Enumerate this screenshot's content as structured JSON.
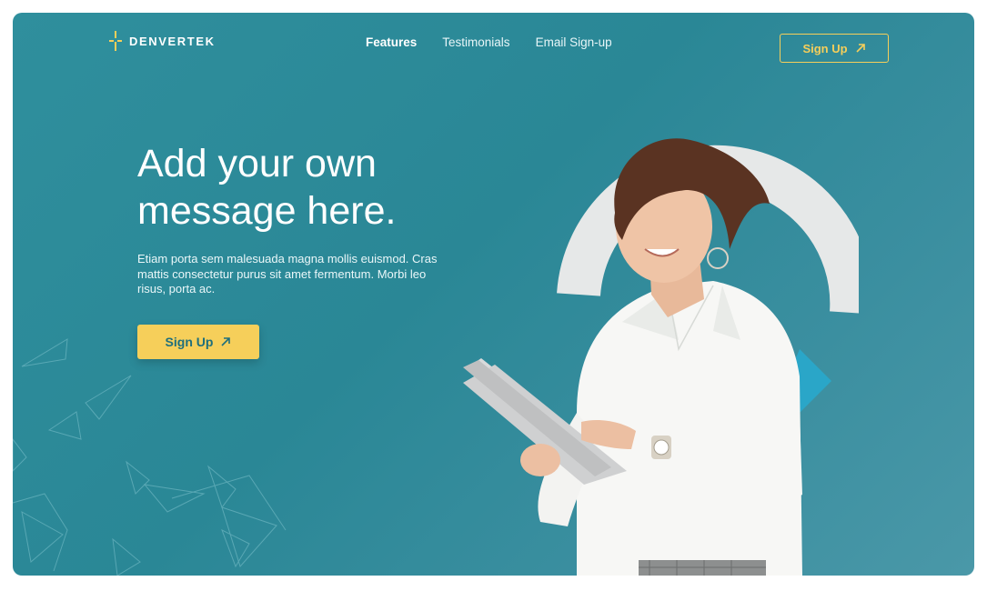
{
  "brand": {
    "name": "DENVERTEK",
    "logo_icon": "cross-bracket-logo-icon",
    "logo_color": "#f6cf5a"
  },
  "nav": {
    "items": [
      {
        "label": "Features",
        "active": true
      },
      {
        "label": "Testimonials",
        "active": false
      },
      {
        "label": "Email Sign-up",
        "active": false
      }
    ]
  },
  "header_cta": {
    "label": "Sign Up",
    "icon": "arrow-up-right-icon"
  },
  "hero": {
    "headline": "Add your own message here.",
    "body": "Etiam porta sem malesuada magna mollis euismod. Cras mattis consectetur purus sit amet fermentum. Morbi leo risus, porta ac.",
    "cta_label": "Sign Up",
    "cta_icon": "arrow-up-right-icon",
    "image": "woman-using-tablet-photo"
  },
  "colors": {
    "background": "#2f8f9d",
    "accent": "#f6cf5a",
    "text": "#ffffff",
    "arc": "#e6e8e8",
    "shape": "#2aa6c8"
  }
}
